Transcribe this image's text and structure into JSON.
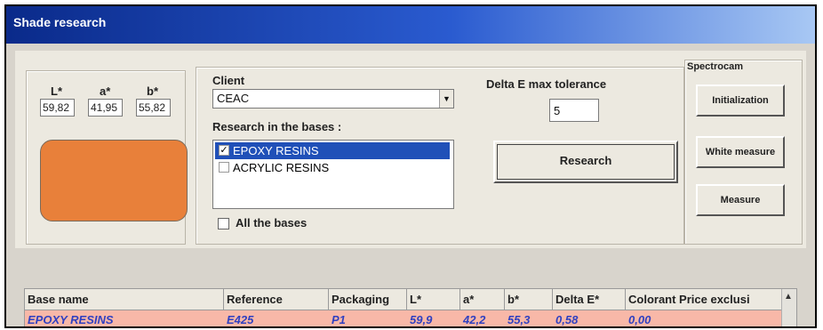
{
  "window": {
    "title": "Shade research"
  },
  "lab": {
    "labels": {
      "l": "L*",
      "a": "a*",
      "b": "b*"
    },
    "values": {
      "l": "59,82",
      "a": "41,95",
      "b": "55,82"
    },
    "swatch_color": "#e8803a"
  },
  "client": {
    "label": "Client",
    "value": "CEAC"
  },
  "bases": {
    "label": "Research in the bases :",
    "items": [
      {
        "label": "EPOXY RESINS",
        "checked": true,
        "selected": true
      },
      {
        "label": "ACRYLIC RESINS",
        "checked": false,
        "selected": false
      }
    ],
    "all_label": "All the bases"
  },
  "tolerance": {
    "label": "Delta E max tolerance",
    "value": "5"
  },
  "research_button": "Research",
  "spectrocam": {
    "label": "Spectrocam",
    "buttons": [
      "Initialization",
      "White measure",
      "Measure"
    ]
  },
  "table": {
    "columns": [
      "Base name",
      "Reference",
      "Packaging",
      "L*",
      "a*",
      "b*",
      "Delta E*",
      "Colorant Price exclusi"
    ],
    "rows": [
      [
        "EPOXY RESINS",
        "E425",
        "P1",
        "59,9",
        "42,2",
        "55,3",
        "0,58",
        "0,00"
      ]
    ]
  },
  "colors": {
    "selection": "#2050b8",
    "row_highlight": "#f8b8a8",
    "cell_text": "#3040c0"
  }
}
